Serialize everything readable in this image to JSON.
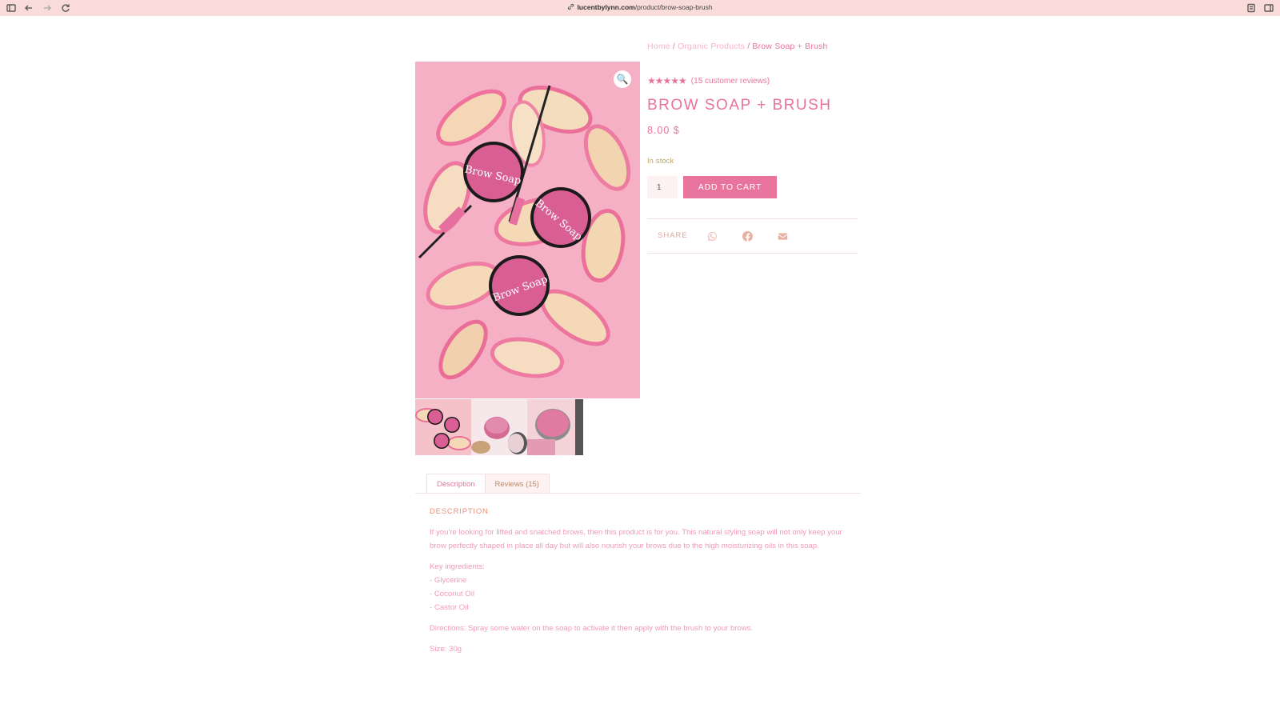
{
  "browser": {
    "url_host": "lucentbylynn.com",
    "url_path": "/product/brow-soap-brush"
  },
  "breadcrumb": {
    "home": "Home",
    "category": "Organic Products",
    "current": "Brow Soap + Brush",
    "separator": "/"
  },
  "product": {
    "rating_stars": "★★★★★",
    "rating_value": 5,
    "review_link": "(15 customer reviews)",
    "title": "BROW SOAP + BRUSH",
    "price": "8.00 $",
    "stock": "In stock",
    "quantity": "1",
    "add_to_cart": "ADD TO CART",
    "zoom_icon": "🔍"
  },
  "share": {
    "label": "SHARE",
    "icons": [
      "whatsapp-icon",
      "facebook-icon",
      "email-icon"
    ]
  },
  "tabs": {
    "description": "Description",
    "reviews": "Reviews (15)"
  },
  "description": {
    "heading": "DESCRIPTION",
    "intro": "If you're looking for lifted and snatched brows, then this product is for you. This natural styling soap will not only keep your brow perfectly shaped in place all day but will also nourish your brows due to the high moisturizing oils in this soap.",
    "ingredients_label": "Key ingredients:",
    "ingredients": [
      "- Glycerine",
      "- Coconut Oil",
      "- Castor Oil"
    ],
    "directions": "Directions: Spray some water on the soap to activate it then apply with the brush to your brows.",
    "size": "Size: 30g"
  },
  "product_image_text": "Brow Soap",
  "colors": {
    "accent": "#e8739c",
    "light_accent": "#f6b6c6",
    "chrome": "#f9dcd9",
    "background": "#ffffff"
  }
}
